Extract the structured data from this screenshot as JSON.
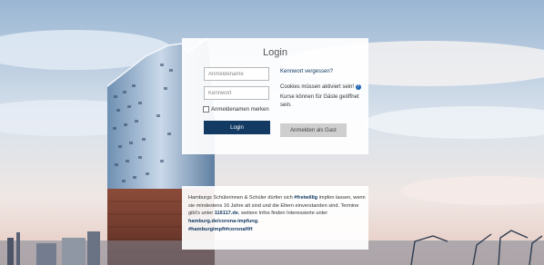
{
  "login": {
    "title": "Login",
    "username_placeholder": "Anmeldename",
    "password_placeholder": "Kennwort",
    "remember_label": "Anmeldenamen merken",
    "login_button": "Login",
    "forgot_link": "Kennwort vergessen?",
    "cookies_text": "Cookies müssen aktiviert sein!",
    "help_icon": "question-circle-icon",
    "guest_text": "Kurse können für Gäste geöffnet sein.",
    "guest_button": "Anmelden als Gast"
  },
  "info": {
    "t1": "Hamburgs Schülerinnen & Schüler dürfen sich ",
    "b1": "#freiwillig",
    "t2": " impfen lassen, wenn sie mindestens 16 Jahre alt sind und die Eltern einverstanden sind. Termine gibt's unter ",
    "b2": "116117.de",
    "t3": ", weitere Infos finden Interessierte unter ",
    "b3": "hamburg.de/corona-impfung",
    "t4": ".",
    "b4": "#hamburgimpft#coronaHH"
  },
  "colors": {
    "primary": "#123a63",
    "guest_button": "#cfcfcf",
    "help_icon": "#1d63b0"
  }
}
